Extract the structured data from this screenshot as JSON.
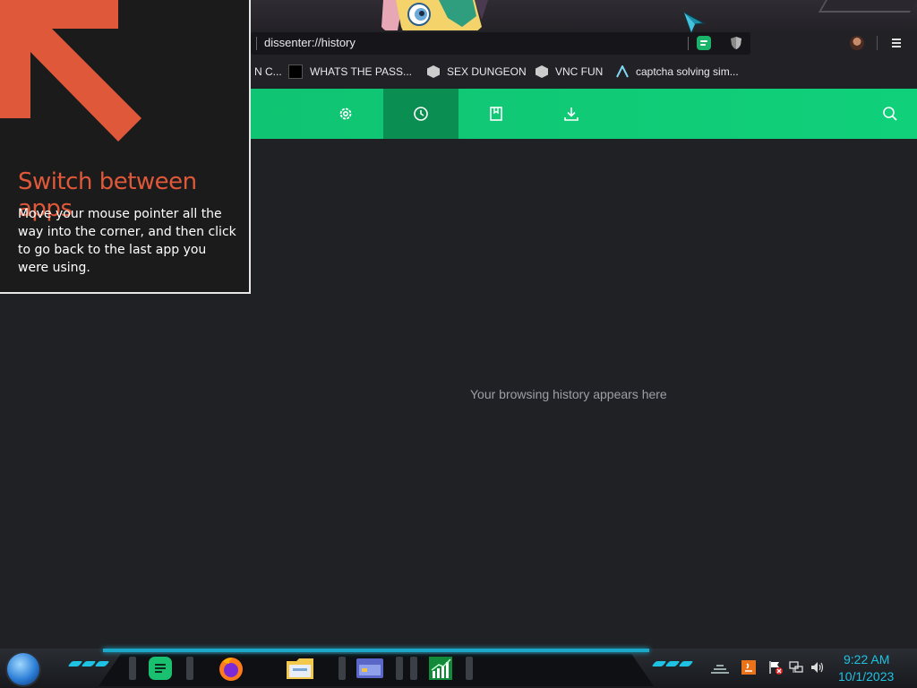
{
  "browser": {
    "url": "dissenter://history",
    "bookmarks": [
      {
        "label": "N C...",
        "icon": "none"
      },
      {
        "label": "WHATS THE PASS...",
        "icon": "dark-square-icon"
      },
      {
        "label": "SEX DUNGEON",
        "icon": "cube-icon"
      },
      {
        "label": "VNC FUN",
        "icon": "cube-icon"
      },
      {
        "label": "captcha solving sim...",
        "icon": "caret-logo-icon"
      }
    ],
    "nav": {
      "settings": "settings-gear-icon",
      "history": "history-clock-icon",
      "bookmarks": "bookmark-book-icon",
      "downloads": "download-icon",
      "search": "search-icon",
      "active": "history"
    },
    "empty_message": "Your browsing history appears here"
  },
  "tip": {
    "title": "Switch between apps",
    "body": "Move your mouse pointer all the way into the corner, and then click to go back to the last app you were using."
  },
  "taskbar": {
    "apps": [
      "chat-app-icon",
      "firefox-icon",
      "file-explorer-icon",
      "window-app-icon",
      "stock-chart-icon"
    ],
    "time": "9:22 AM",
    "date": "10/1/2023"
  },
  "colors": {
    "accent_green": "#10d07a",
    "tip_title": "#e0583a",
    "clock": "#1ec3e3"
  }
}
